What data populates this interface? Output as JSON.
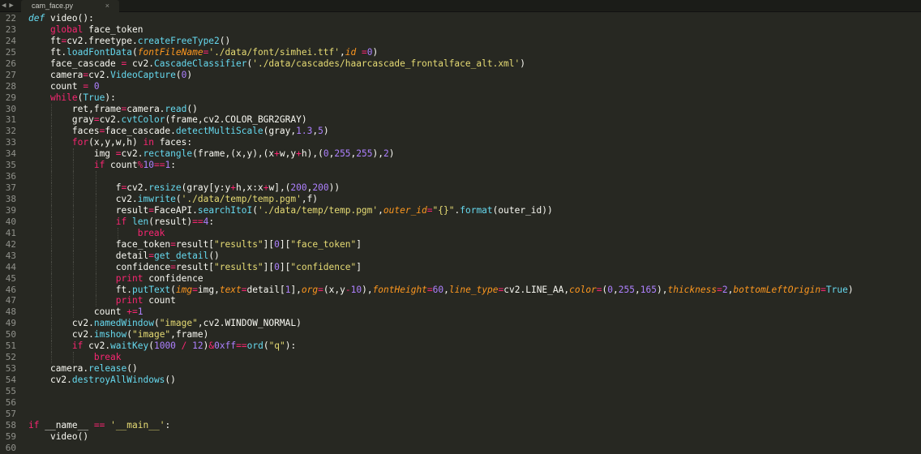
{
  "tab": {
    "title": "cam_face.py",
    "close_glyph": "×"
  },
  "nav": {
    "back_glyph": "◀",
    "forward_glyph": "▶"
  },
  "colors": {
    "background": "#272822",
    "keyword": "#f92672",
    "builtin": "#66d9ef",
    "string": "#e6db74",
    "number": "#ae81ff",
    "parameter": "#fd971f",
    "text": "#f8f8f2",
    "gutter": "#90918b"
  },
  "lines": [
    {
      "n": "22",
      "indent": 0,
      "t": [
        [
          "kwi",
          "def"
        ],
        [
          "pl",
          " "
        ],
        [
          "pl",
          "video"
        ],
        [
          "pl",
          "():"
        ]
      ]
    },
    {
      "n": "23",
      "indent": 1,
      "t": [
        [
          "kw",
          "global"
        ],
        [
          "pl",
          " face_token"
        ]
      ]
    },
    {
      "n": "24",
      "indent": 1,
      "t": [
        [
          "pl",
          "ft"
        ],
        [
          "op",
          "="
        ],
        [
          "pl",
          "cv2.freetype."
        ],
        [
          "fn",
          "createFreeType2"
        ],
        [
          "pl",
          "()"
        ]
      ]
    },
    {
      "n": "25",
      "indent": 1,
      "t": [
        [
          "pl",
          "ft."
        ],
        [
          "fn",
          "loadFontData"
        ],
        [
          "pl",
          "("
        ],
        [
          "par",
          "fontFileName"
        ],
        [
          "op",
          "="
        ],
        [
          "str",
          "'./data/font/simhei.ttf'"
        ],
        [
          "pl",
          ","
        ],
        [
          "par",
          "id"
        ],
        [
          "pl",
          " "
        ],
        [
          "op",
          "="
        ],
        [
          "num",
          "0"
        ],
        [
          "pl",
          ")"
        ]
      ]
    },
    {
      "n": "26",
      "indent": 1,
      "t": [
        [
          "pl",
          "face_cascade "
        ],
        [
          "op",
          "="
        ],
        [
          "pl",
          " cv2."
        ],
        [
          "fn",
          "CascadeClassifier"
        ],
        [
          "pl",
          "("
        ],
        [
          "str",
          "'./data/cascades/haarcascade_frontalface_alt.xml'"
        ],
        [
          "pl",
          ")"
        ]
      ]
    },
    {
      "n": "27",
      "indent": 1,
      "t": [
        [
          "pl",
          "camera"
        ],
        [
          "op",
          "="
        ],
        [
          "pl",
          "cv2."
        ],
        [
          "fn",
          "VideoCapture"
        ],
        [
          "pl",
          "("
        ],
        [
          "num",
          "0"
        ],
        [
          "pl",
          ")"
        ]
      ]
    },
    {
      "n": "28",
      "indent": 1,
      "t": [
        [
          "pl",
          "count "
        ],
        [
          "op",
          "="
        ],
        [
          "pl",
          " "
        ],
        [
          "num",
          "0"
        ]
      ]
    },
    {
      "n": "29",
      "indent": 1,
      "t": [
        [
          "kw",
          "while"
        ],
        [
          "pl",
          "("
        ],
        [
          "fn",
          "True"
        ],
        [
          "pl",
          "):"
        ]
      ]
    },
    {
      "n": "30",
      "indent": 2,
      "t": [
        [
          "pl",
          "ret,frame"
        ],
        [
          "op",
          "="
        ],
        [
          "pl",
          "camera."
        ],
        [
          "fn",
          "read"
        ],
        [
          "pl",
          "()"
        ]
      ]
    },
    {
      "n": "31",
      "indent": 2,
      "t": [
        [
          "pl",
          "gray"
        ],
        [
          "op",
          "="
        ],
        [
          "pl",
          "cv2."
        ],
        [
          "fn",
          "cvtColor"
        ],
        [
          "pl",
          "(frame,cv2.COLOR_BGR2GRAY)"
        ]
      ]
    },
    {
      "n": "32",
      "indent": 2,
      "t": [
        [
          "pl",
          "faces"
        ],
        [
          "op",
          "="
        ],
        [
          "pl",
          "face_cascade."
        ],
        [
          "fn",
          "detectMultiScale"
        ],
        [
          "pl",
          "(gray,"
        ],
        [
          "num",
          "1.3"
        ],
        [
          "pl",
          ","
        ],
        [
          "num",
          "5"
        ],
        [
          "pl",
          ")"
        ]
      ]
    },
    {
      "n": "33",
      "indent": 2,
      "t": [
        [
          "kw",
          "for"
        ],
        [
          "pl",
          "(x,y,w,h) "
        ],
        [
          "kw",
          "in"
        ],
        [
          "pl",
          " faces:"
        ]
      ]
    },
    {
      "n": "34",
      "indent": 3,
      "t": [
        [
          "pl",
          "img "
        ],
        [
          "op",
          "="
        ],
        [
          "pl",
          "cv2."
        ],
        [
          "fn",
          "rectangle"
        ],
        [
          "pl",
          "(frame,(x,y),(x"
        ],
        [
          "op",
          "+"
        ],
        [
          "pl",
          "w,y"
        ],
        [
          "op",
          "+"
        ],
        [
          "pl",
          "h),("
        ],
        [
          "num",
          "0"
        ],
        [
          "pl",
          ","
        ],
        [
          "num",
          "255"
        ],
        [
          "pl",
          ","
        ],
        [
          "num",
          "255"
        ],
        [
          "pl",
          "),"
        ],
        [
          "num",
          "2"
        ],
        [
          "pl",
          ")"
        ]
      ]
    },
    {
      "n": "35",
      "indent": 3,
      "t": [
        [
          "kw",
          "if"
        ],
        [
          "pl",
          " count"
        ],
        [
          "op",
          "%"
        ],
        [
          "num",
          "10"
        ],
        [
          "op",
          "=="
        ],
        [
          "num",
          "1"
        ],
        [
          "pl",
          ":"
        ]
      ]
    },
    {
      "n": "36",
      "indent": 4,
      "t": []
    },
    {
      "n": "37",
      "indent": 4,
      "t": [
        [
          "pl",
          "f"
        ],
        [
          "op",
          "="
        ],
        [
          "pl",
          "cv2."
        ],
        [
          "fn",
          "resize"
        ],
        [
          "pl",
          "(gray[y:y"
        ],
        [
          "op",
          "+"
        ],
        [
          "pl",
          "h,x:x"
        ],
        [
          "op",
          "+"
        ],
        [
          "pl",
          "w],("
        ],
        [
          "num",
          "200"
        ],
        [
          "pl",
          ","
        ],
        [
          "num",
          "200"
        ],
        [
          "pl",
          "))"
        ]
      ]
    },
    {
      "n": "38",
      "indent": 4,
      "t": [
        [
          "pl",
          "cv2."
        ],
        [
          "fn",
          "imwrite"
        ],
        [
          "pl",
          "("
        ],
        [
          "str",
          "'./data/temp/temp.pgm'"
        ],
        [
          "pl",
          ",f)"
        ]
      ]
    },
    {
      "n": "39",
      "indent": 4,
      "t": [
        [
          "pl",
          "result"
        ],
        [
          "op",
          "="
        ],
        [
          "pl",
          "FaceAPI."
        ],
        [
          "fn",
          "searchItoI"
        ],
        [
          "pl",
          "("
        ],
        [
          "str",
          "'./data/temp/temp.pgm'"
        ],
        [
          "pl",
          ","
        ],
        [
          "par",
          "outer_id"
        ],
        [
          "op",
          "="
        ],
        [
          "str",
          "\"{}\""
        ],
        [
          "pl",
          "."
        ],
        [
          "fn",
          "format"
        ],
        [
          "pl",
          "(outer_id))"
        ]
      ]
    },
    {
      "n": "40",
      "indent": 4,
      "t": [
        [
          "kw",
          "if"
        ],
        [
          "pl",
          " "
        ],
        [
          "fn",
          "len"
        ],
        [
          "pl",
          "(result)"
        ],
        [
          "op",
          "=="
        ],
        [
          "num",
          "4"
        ],
        [
          "pl",
          ":"
        ]
      ]
    },
    {
      "n": "41",
      "indent": 5,
      "t": [
        [
          "kw",
          "break"
        ]
      ]
    },
    {
      "n": "42",
      "indent": 4,
      "t": [
        [
          "pl",
          "face_token"
        ],
        [
          "op",
          "="
        ],
        [
          "pl",
          "result["
        ],
        [
          "str",
          "\"results\""
        ],
        [
          "pl",
          "]["
        ],
        [
          "num",
          "0"
        ],
        [
          "pl",
          "]["
        ],
        [
          "str",
          "\"face_token\""
        ],
        [
          "pl",
          "]"
        ]
      ]
    },
    {
      "n": "43",
      "indent": 4,
      "t": [
        [
          "pl",
          "detail"
        ],
        [
          "op",
          "="
        ],
        [
          "fn",
          "get_detail"
        ],
        [
          "pl",
          "()"
        ]
      ]
    },
    {
      "n": "44",
      "indent": 4,
      "t": [
        [
          "pl",
          "confidence"
        ],
        [
          "op",
          "="
        ],
        [
          "pl",
          "result["
        ],
        [
          "str",
          "\"results\""
        ],
        [
          "pl",
          "]["
        ],
        [
          "num",
          "0"
        ],
        [
          "pl",
          "]["
        ],
        [
          "str",
          "\"confidence\""
        ],
        [
          "pl",
          "]"
        ]
      ]
    },
    {
      "n": "45",
      "indent": 4,
      "t": [
        [
          "kw",
          "print"
        ],
        [
          "pl",
          " confidence"
        ]
      ]
    },
    {
      "n": "46",
      "indent": 4,
      "t": [
        [
          "pl",
          "ft."
        ],
        [
          "fn",
          "putText"
        ],
        [
          "pl",
          "("
        ],
        [
          "par",
          "img"
        ],
        [
          "op",
          "="
        ],
        [
          "pl",
          "img,"
        ],
        [
          "par",
          "text"
        ],
        [
          "op",
          "="
        ],
        [
          "pl",
          "detail["
        ],
        [
          "num",
          "1"
        ],
        [
          "pl",
          "],"
        ],
        [
          "par",
          "org"
        ],
        [
          "op",
          "="
        ],
        [
          "pl",
          "(x,y"
        ],
        [
          "op",
          "-"
        ],
        [
          "num",
          "10"
        ],
        [
          "pl",
          "),"
        ],
        [
          "par",
          "fontHeight"
        ],
        [
          "op",
          "="
        ],
        [
          "num",
          "60"
        ],
        [
          "pl",
          ","
        ],
        [
          "par",
          "line_type"
        ],
        [
          "op",
          "="
        ],
        [
          "pl",
          "cv2.LINE_AA,"
        ],
        [
          "par",
          "color"
        ],
        [
          "op",
          "="
        ],
        [
          "pl",
          "("
        ],
        [
          "num",
          "0"
        ],
        [
          "pl",
          ","
        ],
        [
          "num",
          "255"
        ],
        [
          "pl",
          ","
        ],
        [
          "num",
          "165"
        ],
        [
          "pl",
          "),"
        ],
        [
          "par",
          "thickness"
        ],
        [
          "op",
          "="
        ],
        [
          "num",
          "2"
        ],
        [
          "pl",
          ","
        ],
        [
          "par",
          "bottomLeftOrigin"
        ],
        [
          "op",
          "="
        ],
        [
          "fn",
          "True"
        ],
        [
          "pl",
          ")"
        ]
      ]
    },
    {
      "n": "47",
      "indent": 4,
      "t": [
        [
          "kw",
          "print"
        ],
        [
          "pl",
          " count"
        ]
      ]
    },
    {
      "n": "48",
      "indent": 3,
      "t": [
        [
          "pl",
          "count "
        ],
        [
          "op",
          "+="
        ],
        [
          "num",
          "1"
        ]
      ]
    },
    {
      "n": "49",
      "indent": 2,
      "t": [
        [
          "pl",
          "cv2."
        ],
        [
          "fn",
          "namedWindow"
        ],
        [
          "pl",
          "("
        ],
        [
          "str",
          "\"image\""
        ],
        [
          "pl",
          ",cv2.WINDOW_NORMAL)"
        ]
      ]
    },
    {
      "n": "50",
      "indent": 2,
      "t": [
        [
          "pl",
          "cv2."
        ],
        [
          "fn",
          "imshow"
        ],
        [
          "pl",
          "("
        ],
        [
          "str",
          "\"image\""
        ],
        [
          "pl",
          ",frame)"
        ]
      ]
    },
    {
      "n": "51",
      "indent": 2,
      "t": [
        [
          "kw",
          "if"
        ],
        [
          "pl",
          " cv2."
        ],
        [
          "fn",
          "waitKey"
        ],
        [
          "pl",
          "("
        ],
        [
          "num",
          "1000"
        ],
        [
          "pl",
          " "
        ],
        [
          "op",
          "/"
        ],
        [
          "pl",
          " "
        ],
        [
          "num",
          "12"
        ],
        [
          "pl",
          ")"
        ],
        [
          "op",
          "&"
        ],
        [
          "num",
          "0xff"
        ],
        [
          "op",
          "=="
        ],
        [
          "fn",
          "ord"
        ],
        [
          "pl",
          "("
        ],
        [
          "str",
          "\"q\""
        ],
        [
          "pl",
          "):"
        ]
      ]
    },
    {
      "n": "52",
      "indent": 3,
      "t": [
        [
          "kw",
          "break"
        ]
      ]
    },
    {
      "n": "53",
      "indent": 1,
      "t": [
        [
          "pl",
          "camera."
        ],
        [
          "fn",
          "release"
        ],
        [
          "pl",
          "()"
        ]
      ]
    },
    {
      "n": "54",
      "indent": 1,
      "t": [
        [
          "pl",
          "cv2."
        ],
        [
          "fn",
          "destroyAllWindows"
        ],
        [
          "pl",
          "()"
        ]
      ]
    },
    {
      "n": "55",
      "indent": 0,
      "t": []
    },
    {
      "n": "56",
      "indent": 0,
      "t": []
    },
    {
      "n": "57",
      "indent": 0,
      "t": []
    },
    {
      "n": "58",
      "indent": 0,
      "t": [
        [
          "kw",
          "if"
        ],
        [
          "pl",
          " __name__ "
        ],
        [
          "op",
          "=="
        ],
        [
          "pl",
          " "
        ],
        [
          "str",
          "'__main__'"
        ],
        [
          "pl",
          ":"
        ]
      ]
    },
    {
      "n": "59",
      "indent": 1,
      "t": [
        [
          "pl",
          "video"
        ],
        [
          "pl",
          "()"
        ]
      ]
    },
    {
      "n": "60",
      "indent": 0,
      "t": []
    }
  ]
}
